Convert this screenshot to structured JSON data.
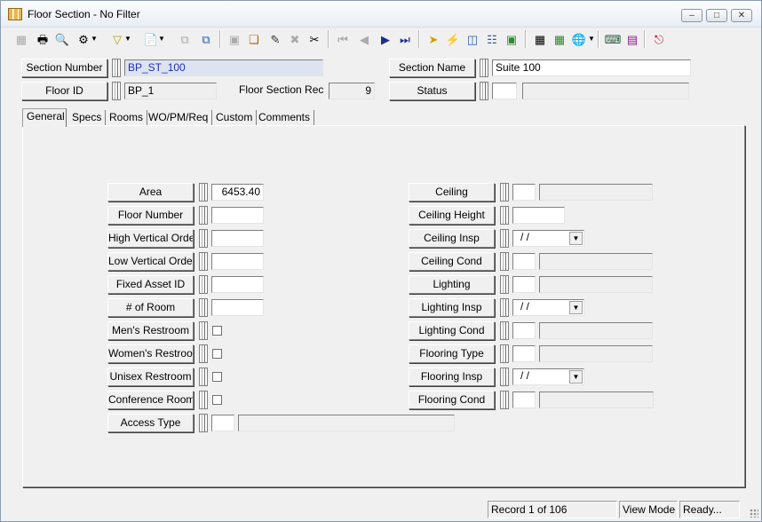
{
  "window": {
    "title": "Floor Section - No Filter",
    "controls": [
      "minimize",
      "maximize",
      "close"
    ]
  },
  "toolbar": {
    "icons": [
      "new-icon",
      "print-icon",
      "print-preview-icon",
      "search-options-icon",
      "filter-icon",
      "report-icon",
      "copy-icon",
      "duplicate-icon",
      "save-icon",
      "attach-icon",
      "edit-icon",
      "delete-icon",
      "cut-icon",
      "first-record-icon",
      "prev-record-icon",
      "next-record-icon",
      "last-record-icon",
      "go-icon",
      "quick-action-icon",
      "workflow-icon",
      "org-chart-icon",
      "image-icon",
      "calculator-icon",
      "map-icon",
      "globe-icon",
      "keyboard-icon",
      "book-icon",
      "exit-icon"
    ]
  },
  "header": {
    "section_number": {
      "label": "Section Number",
      "value": "BP_ST_100"
    },
    "section_name": {
      "label": "Section Name",
      "value": "Suite 100"
    },
    "floor_id": {
      "label": "Floor ID",
      "value": "BP_1"
    },
    "floor_section_rec": {
      "label": "Floor Section Rec #",
      "value": "9"
    },
    "status": {
      "label": "Status",
      "value": "",
      "desc": ""
    }
  },
  "tabs": [
    "General",
    "Specs",
    "Rooms",
    "WO/PM/Req",
    "Custom",
    "Comments"
  ],
  "active_tab": "General",
  "general": {
    "left": [
      {
        "label": "Area",
        "value": "6453.40",
        "type": "text"
      },
      {
        "label": "Floor Number",
        "value": "",
        "type": "text"
      },
      {
        "label": "High Vertical Order",
        "value": "",
        "type": "text"
      },
      {
        "label": "Low Vertical Order",
        "value": "",
        "type": "text"
      },
      {
        "label": "Fixed Asset ID",
        "value": "",
        "type": "text"
      },
      {
        "label": "# of Room",
        "value": "",
        "type": "text"
      },
      {
        "label": "Men's Restroom",
        "value": "",
        "type": "check"
      },
      {
        "label": "Women's Restroom",
        "value": "",
        "type": "check"
      },
      {
        "label": "Unisex Restroom",
        "value": "",
        "type": "check"
      },
      {
        "label": "Conference Room",
        "value": "",
        "type": "check"
      },
      {
        "label": "Access Type",
        "value": "",
        "desc": "",
        "type": "code"
      }
    ],
    "right": [
      {
        "label": "Ceiling",
        "value": "",
        "desc": "",
        "type": "code"
      },
      {
        "label": "Ceiling Height",
        "value": "",
        "type": "text"
      },
      {
        "label": "Ceiling Insp",
        "value": "/ /",
        "type": "date"
      },
      {
        "label": "Ceiling Cond",
        "value": "",
        "desc": "",
        "type": "code"
      },
      {
        "label": "Lighting",
        "value": "",
        "desc": "",
        "type": "code"
      },
      {
        "label": "Lighting Insp",
        "value": "/ /",
        "type": "date"
      },
      {
        "label": "Lighting Cond",
        "value": "",
        "desc": "",
        "type": "code"
      },
      {
        "label": "Flooring Type",
        "value": "",
        "desc": "",
        "type": "code"
      },
      {
        "label": "Flooring Insp",
        "value": "/ /",
        "type": "date"
      },
      {
        "label": "Flooring Cond",
        "value": "",
        "desc": "",
        "type": "code"
      }
    ]
  },
  "statusbar": {
    "record": "Record 1 of 106",
    "mode": "View Mode",
    "state": "Ready..."
  }
}
